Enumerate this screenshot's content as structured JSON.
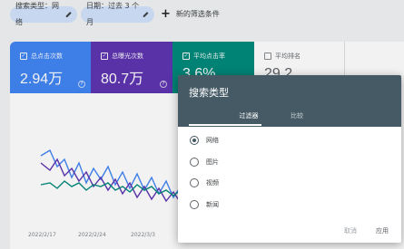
{
  "topbar": {
    "chip_type": "搜索类型：网络",
    "chip_date": "日期：过去 3 个月",
    "new_filter": "新的筛选条件"
  },
  "metrics": [
    {
      "label": "总点击次数",
      "value": "2.94万",
      "checked": true
    },
    {
      "label": "总曝光次数",
      "value": "80.7万",
      "checked": true
    },
    {
      "label": "平均点击率",
      "value": "3.6%",
      "checked": true
    },
    {
      "label": "平均排名",
      "value": "29.2",
      "checked": false
    }
  ],
  "chart": {
    "xticks": [
      "2022/2/17",
      "2022/2/24",
      "2022/3/3"
    ],
    "series_colors": {
      "clicks": "#4285f4",
      "impressions": "#5e35b1",
      "ctr": "#00897b"
    }
  },
  "dialog": {
    "title": "搜索类型",
    "tabs": [
      "过滤器",
      "比较"
    ],
    "active_tab": 0,
    "options": [
      "网络",
      "图片",
      "视频",
      "新闻"
    ],
    "selected": 0,
    "cancel": "取消",
    "apply": "应用"
  }
}
